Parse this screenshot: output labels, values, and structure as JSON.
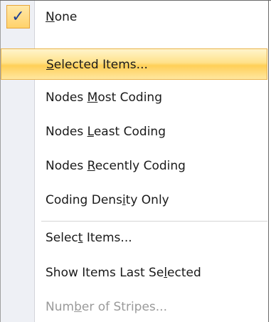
{
  "menu": {
    "check_glyph": "✓",
    "items": [
      {
        "label_pre": "",
        "accel": "N",
        "label_post": "one",
        "checked": true,
        "highlighted": false,
        "disabled": false
      },
      {
        "label_pre": "",
        "accel": "S",
        "label_post": "elected Items...",
        "checked": false,
        "highlighted": true,
        "disabled": false
      },
      {
        "label_pre": "Nodes ",
        "accel": "M",
        "label_post": "ost Coding",
        "checked": false,
        "highlighted": false,
        "disabled": false
      },
      {
        "label_pre": "Nodes ",
        "accel": "L",
        "label_post": "east Coding",
        "checked": false,
        "highlighted": false,
        "disabled": false
      },
      {
        "label_pre": "Nodes ",
        "accel": "R",
        "label_post": "ecently Coding",
        "checked": false,
        "highlighted": false,
        "disabled": false
      },
      {
        "label_pre": "Coding Dens",
        "accel": "i",
        "label_post": "ty Only",
        "checked": false,
        "highlighted": false,
        "disabled": false
      },
      {
        "label_pre": "Selec",
        "accel": "t",
        "label_post": " Items...",
        "checked": false,
        "highlighted": false,
        "disabled": false
      },
      {
        "label_pre": "Show Items Last Se",
        "accel": "l",
        "label_post": "ected",
        "checked": false,
        "highlighted": false,
        "disabled": false
      },
      {
        "label_pre": "Num",
        "accel": "b",
        "label_post": "er of Stripes...",
        "checked": false,
        "highlighted": false,
        "disabled": true
      }
    ]
  }
}
